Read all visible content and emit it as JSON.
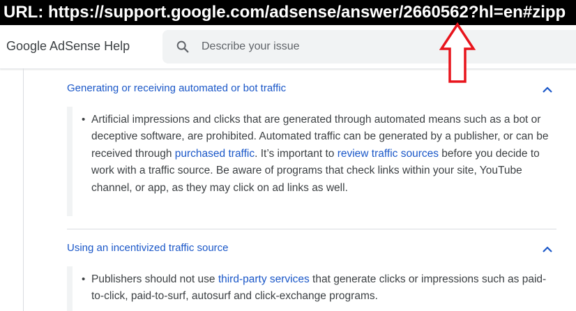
{
  "banner": {
    "text": "URL: https://support.google.com/adsense/answer/2660562?hl=en#zipp"
  },
  "header": {
    "brand": "Google AdSense Help",
    "search_placeholder": "Describe your issue"
  },
  "sections": [
    {
      "title": "Generating or receiving automated or bot traffic",
      "bullet": "•",
      "parts": [
        "Artificial impressions and clicks that are generated through automated means such as a bot or deceptive software, are prohibited. Automated traffic can be generated by a publisher, or can be received through ",
        "purchased traffic",
        ". It’s important to ",
        "review traffic sources",
        " before you decide to work with a traffic source. Be aware of programs that check links within your site, YouTube channel, or app, as they may click on ad links as well."
      ]
    },
    {
      "title": "Using an incentivized traffic source",
      "bullet": "•",
      "parts": [
        "Publishers should not use ",
        "third-party services",
        " that generate clicks or impressions such as paid-to-click, paid-to-surf, autosurf and click-exchange programs."
      ]
    }
  ],
  "colors": {
    "link": "#1a57c8",
    "annotation_arrow": "#e8141c"
  },
  "icons": {
    "search": "search-icon",
    "collapse": "chevron-up-icon",
    "annotation": "arrow-up-icon"
  }
}
